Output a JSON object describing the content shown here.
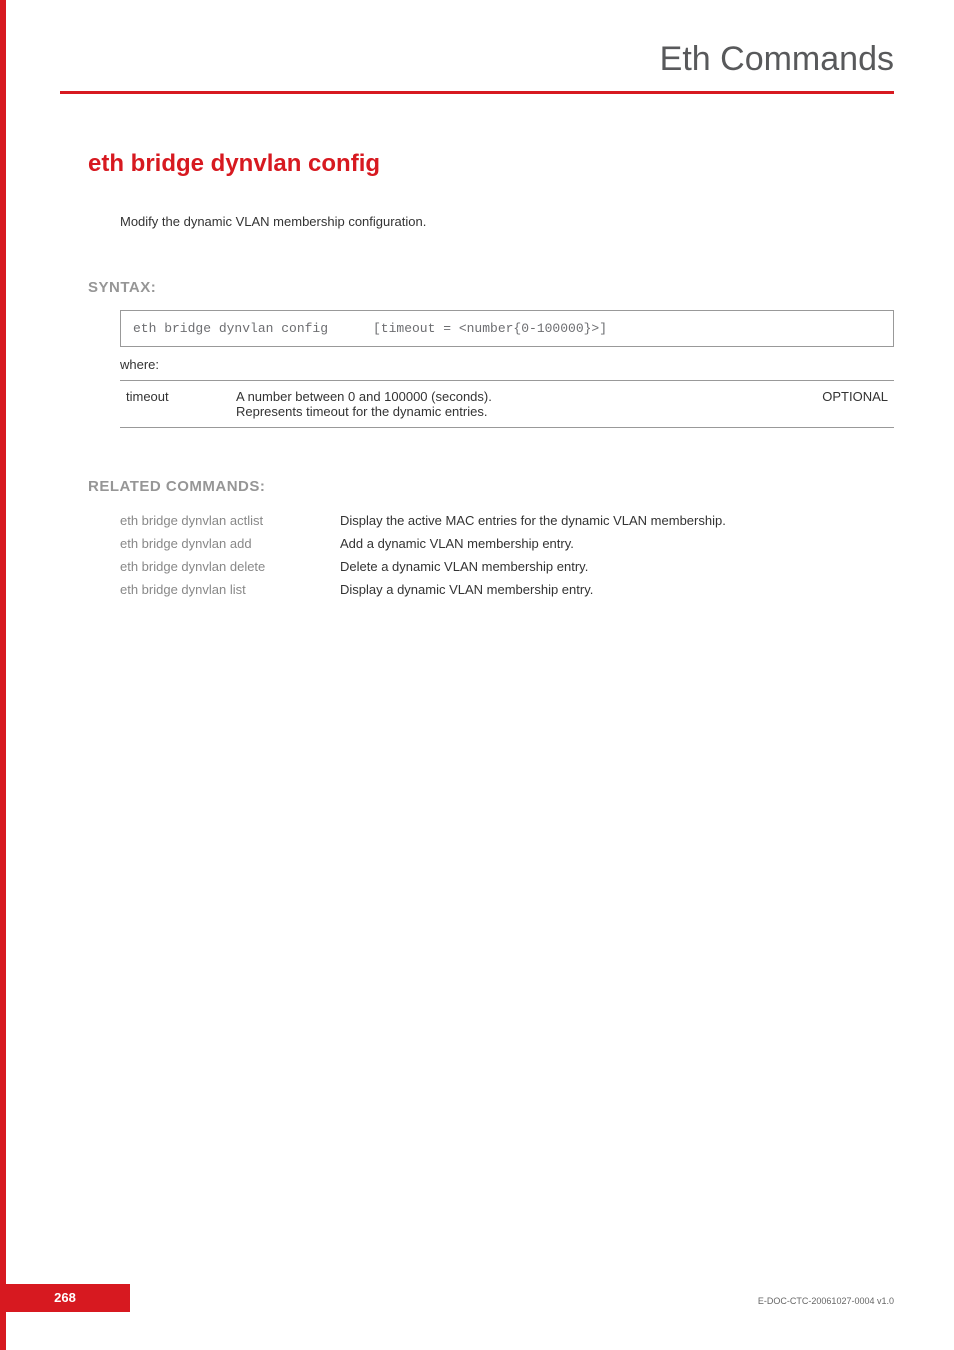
{
  "header": {
    "title": "Eth Commands"
  },
  "command": {
    "title": "eth bridge dynvlan config",
    "description": "Modify the dynamic VLAN membership configuration."
  },
  "syntax": {
    "section_label": "SYNTAX:",
    "cmd": "eth bridge dynvlan config",
    "args": "[timeout = <number{0-100000}>]",
    "where_label": "where:",
    "params": [
      {
        "name": "timeout",
        "desc_line1": "A number between 0 and 100000 (seconds).",
        "desc_line2": "Represents timeout for the dynamic entries.",
        "opt": "OPTIONAL"
      }
    ]
  },
  "related": {
    "section_label": "RELATED COMMANDS:",
    "items": [
      {
        "name": "eth bridge dynvlan actlist",
        "desc": "Display the active MAC entries for the dynamic VLAN membership."
      },
      {
        "name": "eth bridge dynvlan add",
        "desc": "Add a dynamic VLAN membership entry."
      },
      {
        "name": "eth bridge dynvlan delete",
        "desc": "Delete a dynamic VLAN membership entry."
      },
      {
        "name": "eth bridge dynvlan list",
        "desc": "Display a dynamic VLAN membership entry."
      }
    ]
  },
  "footer": {
    "page": "268",
    "doc_code": "E-DOC-CTC-20061027-0004 v1.0"
  }
}
